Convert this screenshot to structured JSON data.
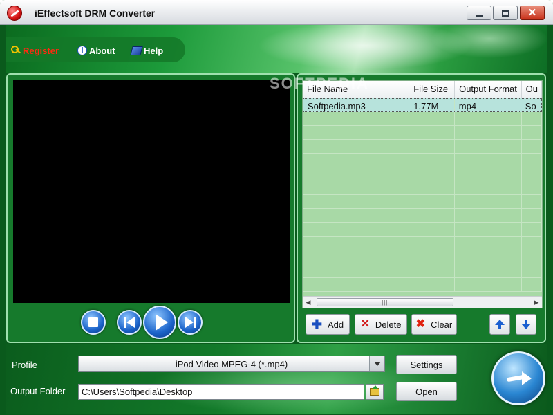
{
  "window": {
    "title": "iEffectsoft DRM Converter"
  },
  "menu": {
    "register": "Register",
    "about": "About",
    "help": "Help"
  },
  "watermark": "SOFTPEDIA",
  "file_table": {
    "columns": [
      "File Name",
      "File Size",
      "Output Format",
      "Ou"
    ],
    "rows": [
      [
        "Softpedia.mp3",
        "1.77M",
        "mp4",
        "So"
      ]
    ],
    "scroll_grip": "|||"
  },
  "actions": {
    "add": "Add",
    "delete": "Delete",
    "clear": "Clear"
  },
  "bottom": {
    "profile_label": "Profile",
    "profile_value": "iPod Video MPEG-4 (*.mp4)",
    "output_folder_label": "Output Folder",
    "output_folder_value": "C:\\Users\\Softpedia\\Desktop",
    "settings": "Settings",
    "open": "Open"
  },
  "icons": {
    "register": "key-icon",
    "about": "info-icon",
    "help": "book-icon",
    "stop": "stop-icon",
    "prev": "skip-back-icon",
    "play": "play-icon",
    "next": "skip-forward-icon",
    "add": "plus-icon",
    "delete": "x-icon",
    "clear": "x-icon",
    "move_up": "arrow-up-icon",
    "move_down": "arrow-down-icon",
    "browse": "folder-icon",
    "convert": "convert-arrow-icon"
  },
  "colors": {
    "accent_green": "#167a2c",
    "table_bg": "#a8d9a6",
    "register_red": "#ff2a10"
  }
}
